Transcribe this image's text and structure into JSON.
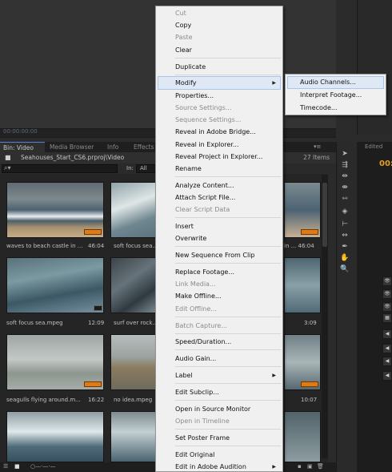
{
  "monitor": {
    "timecode": "00:00:00:00"
  },
  "tabs": [
    {
      "label": "Bin: Video"
    },
    {
      "label": "Media Browser"
    },
    {
      "label": "Info"
    },
    {
      "label": "Effects"
    }
  ],
  "project": {
    "path": "Seahouses_Start_CS6.prproj\\Video",
    "item_count": "27 Items"
  },
  "search": {
    "placeholder": "",
    "in_label": "In:",
    "in_value": "All"
  },
  "clips": [
    {
      "name": "waves to beach castle in ...",
      "duration": "46:04"
    },
    {
      "name": "soft focus sea...",
      "duration": ""
    },
    {
      "name": "",
      "duration": "in ... 46:04"
    },
    {
      "name": "soft focus sea.mpeg",
      "duration": "12:09"
    },
    {
      "name": "surf over rock...",
      "duration": ""
    },
    {
      "name": "",
      "duration": "3:09"
    },
    {
      "name": "seagulls flying around.m...",
      "duration": "16:22"
    },
    {
      "name": "no idea.mpeg",
      "duration": ""
    },
    {
      "name": "",
      "duration": "10:07"
    }
  ],
  "right_panel": {
    "tab": "Edited",
    "timecode": "00:"
  },
  "context_menu": {
    "items": [
      {
        "label": "Cut",
        "enabled": false
      },
      {
        "label": "Copy",
        "enabled": true
      },
      {
        "label": "Paste",
        "enabled": false
      },
      {
        "label": "Clear",
        "enabled": true
      },
      {
        "label": "Duplicate",
        "enabled": true
      },
      {
        "label": "Modify",
        "enabled": true
      },
      {
        "label": "Properties...",
        "enabled": true
      },
      {
        "label": "Source Settings...",
        "enabled": false
      },
      {
        "label": "Sequence Settings...",
        "enabled": false
      },
      {
        "label": "Reveal in Adobe Bridge...",
        "enabled": true
      },
      {
        "label": "Reveal in Explorer...",
        "enabled": true
      },
      {
        "label": "Reveal Project in Explorer...",
        "enabled": true
      },
      {
        "label": "Rename",
        "enabled": true
      },
      {
        "label": "Analyze Content...",
        "enabled": true
      },
      {
        "label": "Attach Script File...",
        "enabled": true
      },
      {
        "label": "Clear Script Data",
        "enabled": false
      },
      {
        "label": "Insert",
        "enabled": true
      },
      {
        "label": "Overwrite",
        "enabled": true
      },
      {
        "label": "New Sequence From Clip",
        "enabled": true
      },
      {
        "label": "Replace Footage...",
        "enabled": true
      },
      {
        "label": "Link Media...",
        "enabled": false
      },
      {
        "label": "Make Offline...",
        "enabled": true
      },
      {
        "label": "Edit Offline...",
        "enabled": false
      },
      {
        "label": "Batch Capture...",
        "enabled": false
      },
      {
        "label": "Speed/Duration...",
        "enabled": true
      },
      {
        "label": "Audio Gain...",
        "enabled": true
      },
      {
        "label": "Label",
        "enabled": true
      },
      {
        "label": "Edit Subclip...",
        "enabled": true
      },
      {
        "label": "Open in Source Monitor",
        "enabled": true
      },
      {
        "label": "Open in Timeline",
        "enabled": false
      },
      {
        "label": "Set Poster Frame",
        "enabled": true
      },
      {
        "label": "Edit Original",
        "enabled": true
      },
      {
        "label": "Edit in Adobe Audition",
        "enabled": true
      }
    ]
  },
  "submenu": {
    "items": [
      {
        "label": "Audio Channels..."
      },
      {
        "label": "Interpret Footage..."
      },
      {
        "label": "Timecode..."
      }
    ]
  },
  "colors": {
    "accent": "#5a7fd6",
    "badge": "#e07a14",
    "timecode": "#e3a020",
    "highlight": "#dfe9f6"
  }
}
